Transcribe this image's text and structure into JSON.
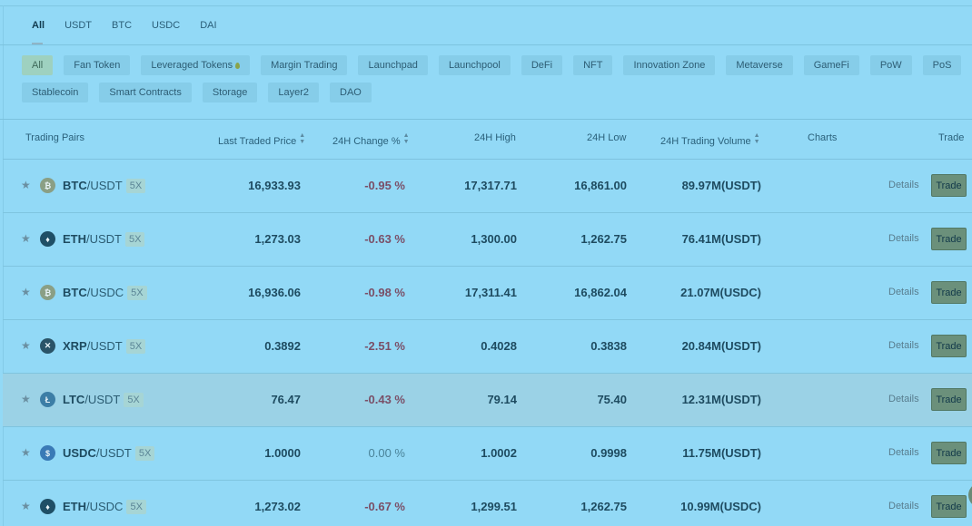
{
  "quote_tabs": [
    "All",
    "USDT",
    "BTC",
    "USDC",
    "DAI"
  ],
  "categories_row1": [
    "All",
    "Fan Token",
    "Leveraged Tokens",
    "Margin Trading",
    "Launchpad",
    "Launchpool",
    "DeFi",
    "NFT",
    "Innovation Zone",
    "Metaverse",
    "GameFi",
    "PoW",
    "PoS"
  ],
  "categories_row2": [
    "Stablecoin",
    "Smart Contracts",
    "Storage",
    "Layer2",
    "DAO"
  ],
  "columns": {
    "pair": "Trading Pairs",
    "price": "Last Traded Price",
    "change": "24H Change %",
    "high": "24H High",
    "low": "24H Low",
    "volume": "24H Trading Volume",
    "charts": "Charts",
    "trade": "Trade"
  },
  "rows": [
    {
      "base": "BTC",
      "quote": "/USDT",
      "leverage": "5X",
      "price": "16,933.93",
      "change": "-0.95 %",
      "high": "17,317.71",
      "low": "16,861.00",
      "volume": "89.97M(USDT)",
      "details": "Details",
      "trade": "Trade",
      "icon": "bitcoin-icon",
      "color": "#8a9f85"
    },
    {
      "base": "ETH",
      "quote": "/USDT",
      "leverage": "5X",
      "price": "1,273.03",
      "change": "-0.63 %",
      "high": "1,300.00",
      "low": "1,262.75",
      "volume": "76.41M(USDT)",
      "details": "Details",
      "trade": "Trade",
      "icon": "ethereum-icon",
      "color": "#1f4f66"
    },
    {
      "base": "BTC",
      "quote": "/USDC",
      "leverage": "5X",
      "price": "16,936.06",
      "change": "-0.98 %",
      "high": "17,311.41",
      "low": "16,862.04",
      "volume": "21.07M(USDC)",
      "details": "Details",
      "trade": "Trade",
      "icon": "bitcoin-icon",
      "color": "#8a9f85"
    },
    {
      "base": "XRP",
      "quote": "/USDT",
      "leverage": "5X",
      "price": "0.3892",
      "change": "-2.51 %",
      "high": "0.4028",
      "low": "0.3838",
      "volume": "20.84M(USDT)",
      "details": "Details",
      "trade": "Trade",
      "icon": "xrp-icon",
      "color": "#2a5468"
    },
    {
      "base": "LTC",
      "quote": "/USDT",
      "leverage": "5X",
      "price": "76.47",
      "change": "-0.43 %",
      "high": "79.14",
      "low": "75.40",
      "volume": "12.31M(USDT)",
      "details": "Details",
      "trade": "Trade",
      "icon": "litecoin-icon",
      "color": "#3c7ea6"
    },
    {
      "base": "USDC",
      "quote": "/USDT",
      "leverage": "5X",
      "price": "1.0000",
      "change": "0.00 %",
      "high": "1.0002",
      "low": "0.9998",
      "volume": "11.75M(USDT)",
      "details": "Details",
      "trade": "Trade",
      "icon": "usdc-icon",
      "color": "#3a7ab6"
    },
    {
      "base": "ETH",
      "quote": "/USDC",
      "leverage": "5X",
      "price": "1,273.02",
      "change": "-0.67 %",
      "high": "1,299.51",
      "low": "1,262.75",
      "volume": "10.99M(USDC)",
      "details": "Details",
      "trade": "Trade",
      "icon": "ethereum-icon",
      "color": "#1f4f66"
    }
  ]
}
